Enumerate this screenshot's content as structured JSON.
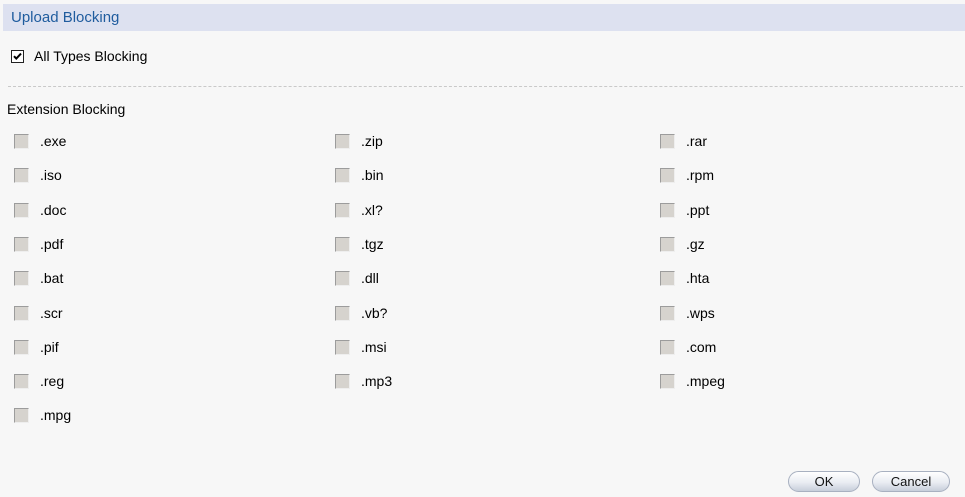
{
  "header": {
    "title": "Upload Blocking"
  },
  "all_types": {
    "label": "All Types Blocking",
    "checked": true
  },
  "extension_section": {
    "heading": "Extension Blocking"
  },
  "extensions": [
    [
      ".exe",
      ".zip",
      ".rar"
    ],
    [
      ".iso",
      ".bin",
      ".rpm"
    ],
    [
      ".doc",
      ".xl?",
      ".ppt"
    ],
    [
      ".pdf",
      ".tgz",
      ".gz"
    ],
    [
      ".bat",
      ".dll",
      ".hta"
    ],
    [
      ".scr",
      ".vb?",
      ".wps"
    ],
    [
      ".pif",
      ".msi",
      ".com"
    ],
    [
      ".reg",
      ".mp3",
      ".mpeg"
    ],
    [
      ".mpg"
    ]
  ],
  "buttons": {
    "ok": "OK",
    "cancel": "Cancel"
  }
}
